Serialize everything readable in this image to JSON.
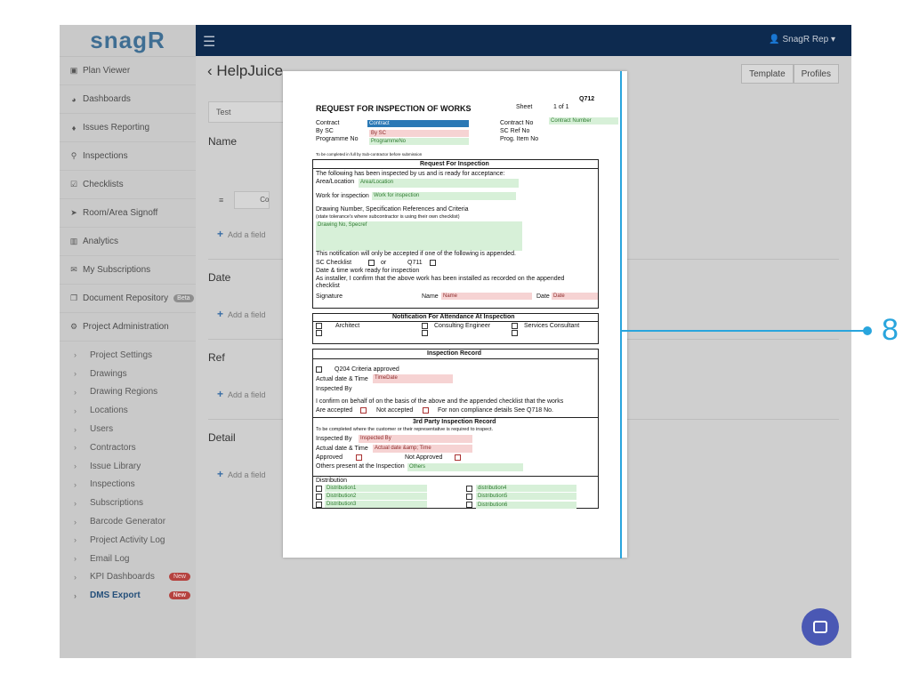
{
  "sidebar": {
    "logo": "snagR",
    "items": [
      {
        "label": "Plan Viewer",
        "icon": "image-icon"
      },
      {
        "label": "Dashboards",
        "icon": "dashboard-icon"
      },
      {
        "label": "Issues Reporting",
        "icon": "pin-icon"
      },
      {
        "label": "Inspections",
        "icon": "search-icon"
      },
      {
        "label": "Checklists",
        "icon": "checkbox-icon"
      },
      {
        "label": "Room/Area Signoff",
        "icon": "send-icon"
      },
      {
        "label": "Analytics",
        "icon": "bar-chart-icon"
      },
      {
        "label": "My Subscriptions",
        "icon": "envelope-icon"
      },
      {
        "label": "Document Repository",
        "icon": "copy-icon",
        "badge": "Beta"
      },
      {
        "label": "Project Administration",
        "icon": "cogs-icon"
      }
    ],
    "sub_items": [
      {
        "label": "Project Settings"
      },
      {
        "label": "Drawings"
      },
      {
        "label": "Drawing Regions"
      },
      {
        "label": "Locations"
      },
      {
        "label": "Users"
      },
      {
        "label": "Contractors"
      },
      {
        "label": "Issue Library"
      },
      {
        "label": "Inspections"
      },
      {
        "label": "Subscriptions"
      },
      {
        "label": "Barcode Generator"
      },
      {
        "label": "Project Activity Log"
      },
      {
        "label": "Email Log"
      },
      {
        "label": "KPI Dashboards",
        "badge": "New"
      },
      {
        "label": "DMS Export",
        "badge": "New",
        "active": true
      }
    ]
  },
  "topbar": {
    "user": "SnagR Rep"
  },
  "main": {
    "title": "HelpJuice",
    "template_button": "Template",
    "profiles_button": "Profiles",
    "test_value": "Test",
    "field_row_text": "Co",
    "sections": [
      {
        "label": "Name",
        "add": "Add a field"
      },
      {
        "label": "Date",
        "add": "Add a field"
      },
      {
        "label": "Ref",
        "add": "Add a field"
      },
      {
        "label": "Detail",
        "add": "Add a field"
      }
    ]
  },
  "doc": {
    "code": "Q712",
    "title": "REQUEST FOR INSPECTION OF WORKS",
    "sheet_label": "Sheet",
    "sheet_value": "1 of 1",
    "contract_label": "Contract",
    "by_sc_label": "By SC",
    "programme_label": "Programme No",
    "contract_field": "Contract",
    "by_sc_field": "By SC",
    "programme_field": "ProgrammeNo",
    "contract_no_label": "Contract No",
    "sc_ref_label": "SC Ref No",
    "prog_item_label": "Prog. Item No",
    "contract_no_field": "Contract Number",
    "note": "To be completed in full by Sub-contractor before submission",
    "s1_title": "Request For Inspection",
    "s1_line1": "The following has been inspected by us and is ready for acceptance:",
    "area_label": "Area/Location",
    "area_field": "Area/Location",
    "work_label": "Work for inspection",
    "work_field": "Work for inspection",
    "drawing_label": "Drawing Number, Specification References and Criteria",
    "drawing_sub": "(state tolerance's where subcontractor is using their own checklist)",
    "drawing_field": "Drawing No, Specref",
    "notification_line": "This notification will only be accepted if one of the following is appended.",
    "sc_checklist": "SC Checklist",
    "or": "or",
    "q711": "Q711",
    "date_time_line": "Date & time work ready for inspection",
    "installer_line1": "As installer, I confirm that the above work has been installed as recorded on the appended",
    "installer_line2": "checklist",
    "signature": "Signature",
    "name_label": "Name",
    "name_field": "Name",
    "date_label": "Date",
    "date_field": "Date",
    "s2_title": "Notification For Attendance At Inspection",
    "architect": "Architect",
    "consulting": "Consulting Engineer",
    "services": "Services Consultant",
    "s3_title": "Inspection Record",
    "q204": "Q204 Criteria approved",
    "actual_label": "Actual date & Time",
    "timedate_field": "TimeDate",
    "inspected_by": "Inspected By",
    "confirm_line": "I confirm on behalf of            on the basis of the above and the appended checklist that the works",
    "are_accepted": "Are accepted",
    "not_accepted": "Not accepted",
    "non_compliance": "For non compliance details See Q718 No.",
    "s4_title": "3rd Party Inspection Record",
    "s4_line": "To be completed where the customer or their representative is required to inspect.",
    "s4_inspected_label": "Inspected By",
    "s4_inspected_field": "Inspected By",
    "s4_actual_label": "Actual date & Time",
    "s4_actual_field": "Actual date &amp; Time",
    "approved": "Approved",
    "not_approved": "Not Approved",
    "others_label": "Others present at the Inspection",
    "others_field": "Others",
    "distribution": "Distribution",
    "dist": [
      "Distribution1",
      "Distribution2",
      "Distribution3",
      "distribution4",
      "Distribution5",
      "Distribution6"
    ]
  },
  "annotation": {
    "number": "8"
  },
  "colors": {
    "topbar": "#0d2a4f",
    "accent": "#29a5dd",
    "chat": "#4a58b4",
    "new_badge": "#b5423f"
  }
}
